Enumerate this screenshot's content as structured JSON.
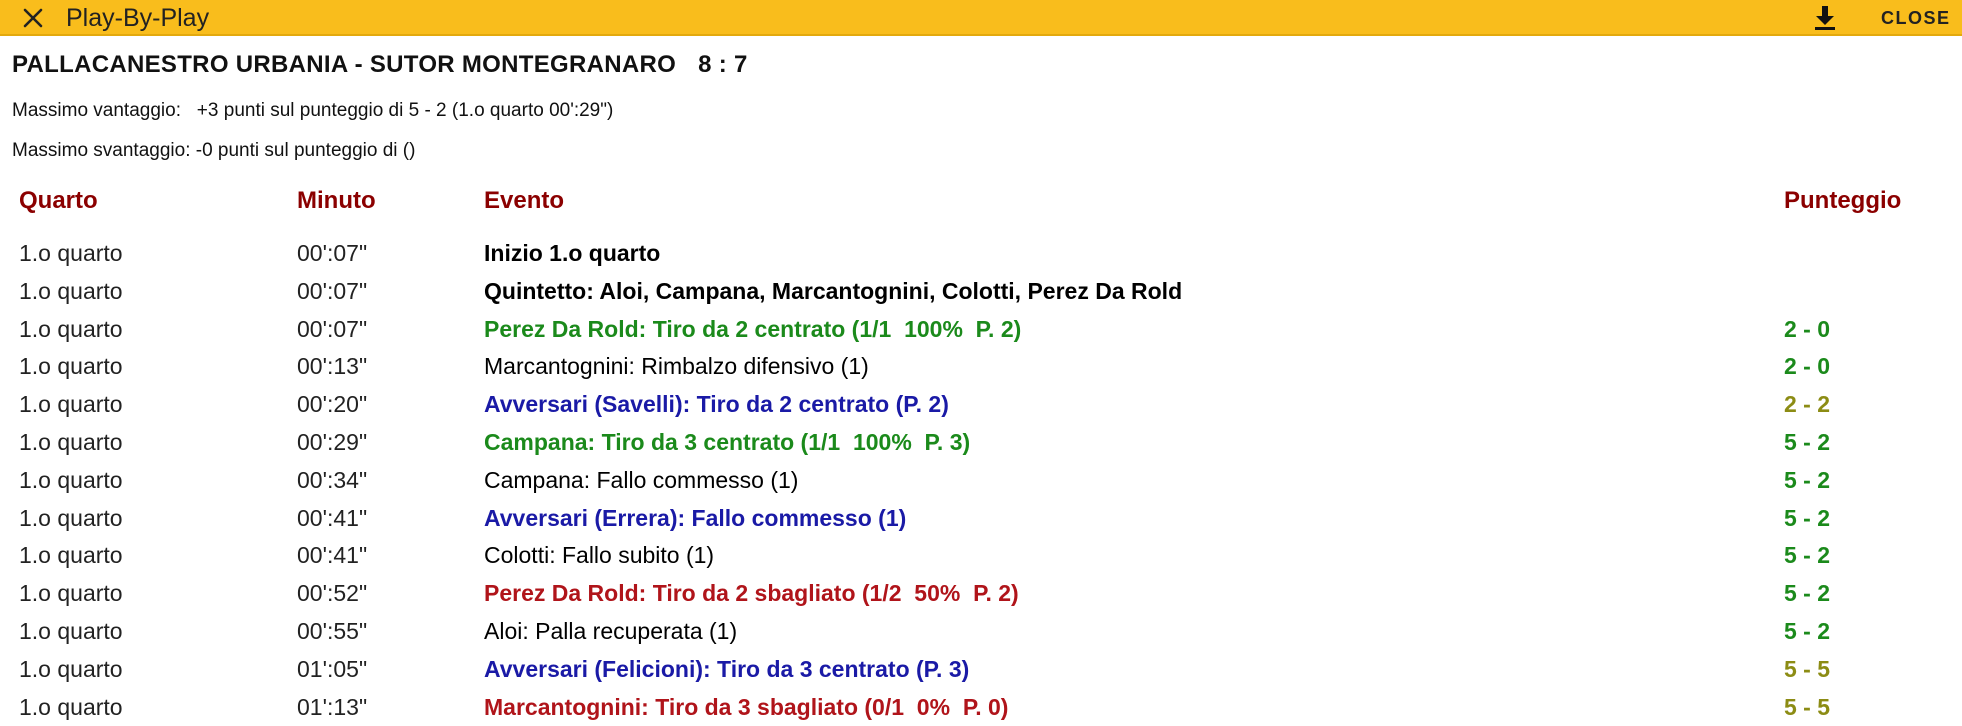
{
  "topbar": {
    "close_icon": "close-x-icon",
    "title": "Play-By-Play",
    "download_icon": "download-icon",
    "close_label": "CLOSE"
  },
  "match": {
    "title": "PALLACANESTRO URBANIA - SUTOR MONTEGRANARO",
    "score": "8 : 7",
    "max_lead": "Massimo vantaggio:   +3 punti sul punteggio di 5 - 2 (1.o quarto 00':29\")",
    "max_deficit": "Massimo svantaggio: -0 punti sul punteggio di ()"
  },
  "colors": {
    "topbar": "#f9bd1c",
    "header": "#8b0000",
    "own_made": "#1b8a1b",
    "opponent": "#1a1aa6",
    "own_missed": "#b0141a",
    "score_lead": "#1b8a1b",
    "score_tie": "#8c8c14"
  },
  "table": {
    "headers": {
      "quarter": "Quarto",
      "minute": "Minuto",
      "event": "Evento",
      "score": "Punteggio"
    },
    "rows": [
      {
        "quarter": "1.o quarto",
        "minute": "00':07\"",
        "event": "Inizio 1.o quarto",
        "score": "",
        "style": "bold-black",
        "score_style": ""
      },
      {
        "quarter": "1.o quarto",
        "minute": "00':07\"",
        "event": "Quintetto: Aloi, Campana, Marcantognini, Colotti, Perez Da Rold",
        "score": "",
        "style": "bold-black",
        "score_style": ""
      },
      {
        "quarter": "1.o quarto",
        "minute": "00':07\"",
        "event": "Perez Da Rold: Tiro da 2 centrato (1/1  100%  P. 2)",
        "score": "2 - 0",
        "style": "bold-green",
        "score_style": "green"
      },
      {
        "quarter": "1.o quarto",
        "minute": "00':13\"",
        "event": "Marcantognini: Rimbalzo difensivo (1)",
        "score": "2 - 0",
        "style": "plain",
        "score_style": "green"
      },
      {
        "quarter": "1.o quarto",
        "minute": "00':20\"",
        "event": "Avversari (Savelli): Tiro da 2 centrato (P. 2)",
        "score": "2 - 2",
        "style": "bold-blue",
        "score_style": "olive"
      },
      {
        "quarter": "1.o quarto",
        "minute": "00':29\"",
        "event": "Campana: Tiro da 3 centrato (1/1  100%  P. 3)",
        "score": "5 - 2",
        "style": "bold-green",
        "score_style": "green"
      },
      {
        "quarter": "1.o quarto",
        "minute": "00':34\"",
        "event": "Campana: Fallo commesso (1)",
        "score": "5 - 2",
        "style": "plain",
        "score_style": "green"
      },
      {
        "quarter": "1.o quarto",
        "minute": "00':41\"",
        "event": "Avversari (Errera): Fallo commesso (1)",
        "score": "5 - 2",
        "style": "bold-blue",
        "score_style": "green"
      },
      {
        "quarter": "1.o quarto",
        "minute": "00':41\"",
        "event": "Colotti: Fallo subito (1)",
        "score": "5 - 2",
        "style": "plain",
        "score_style": "green"
      },
      {
        "quarter": "1.o quarto",
        "minute": "00':52\"",
        "event": "Perez Da Rold: Tiro da 2 sbagliato (1/2  50%  P. 2)",
        "score": "5 - 2",
        "style": "bold-red",
        "score_style": "green"
      },
      {
        "quarter": "1.o quarto",
        "minute": "00':55\"",
        "event": "Aloi: Palla recuperata (1)",
        "score": "5 - 2",
        "style": "plain",
        "score_style": "green"
      },
      {
        "quarter": "1.o quarto",
        "minute": "01':05\"",
        "event": "Avversari (Felicioni): Tiro da 3 centrato (P. 3)",
        "score": "5 - 5",
        "style": "bold-blue",
        "score_style": "olive"
      },
      {
        "quarter": "1.o quarto",
        "minute": "01':13\"",
        "event": "Marcantognini: Tiro da 3 sbagliato (0/1  0%  P. 0)",
        "score": "5 - 5",
        "style": "bold-red",
        "score_style": "olive"
      }
    ]
  }
}
